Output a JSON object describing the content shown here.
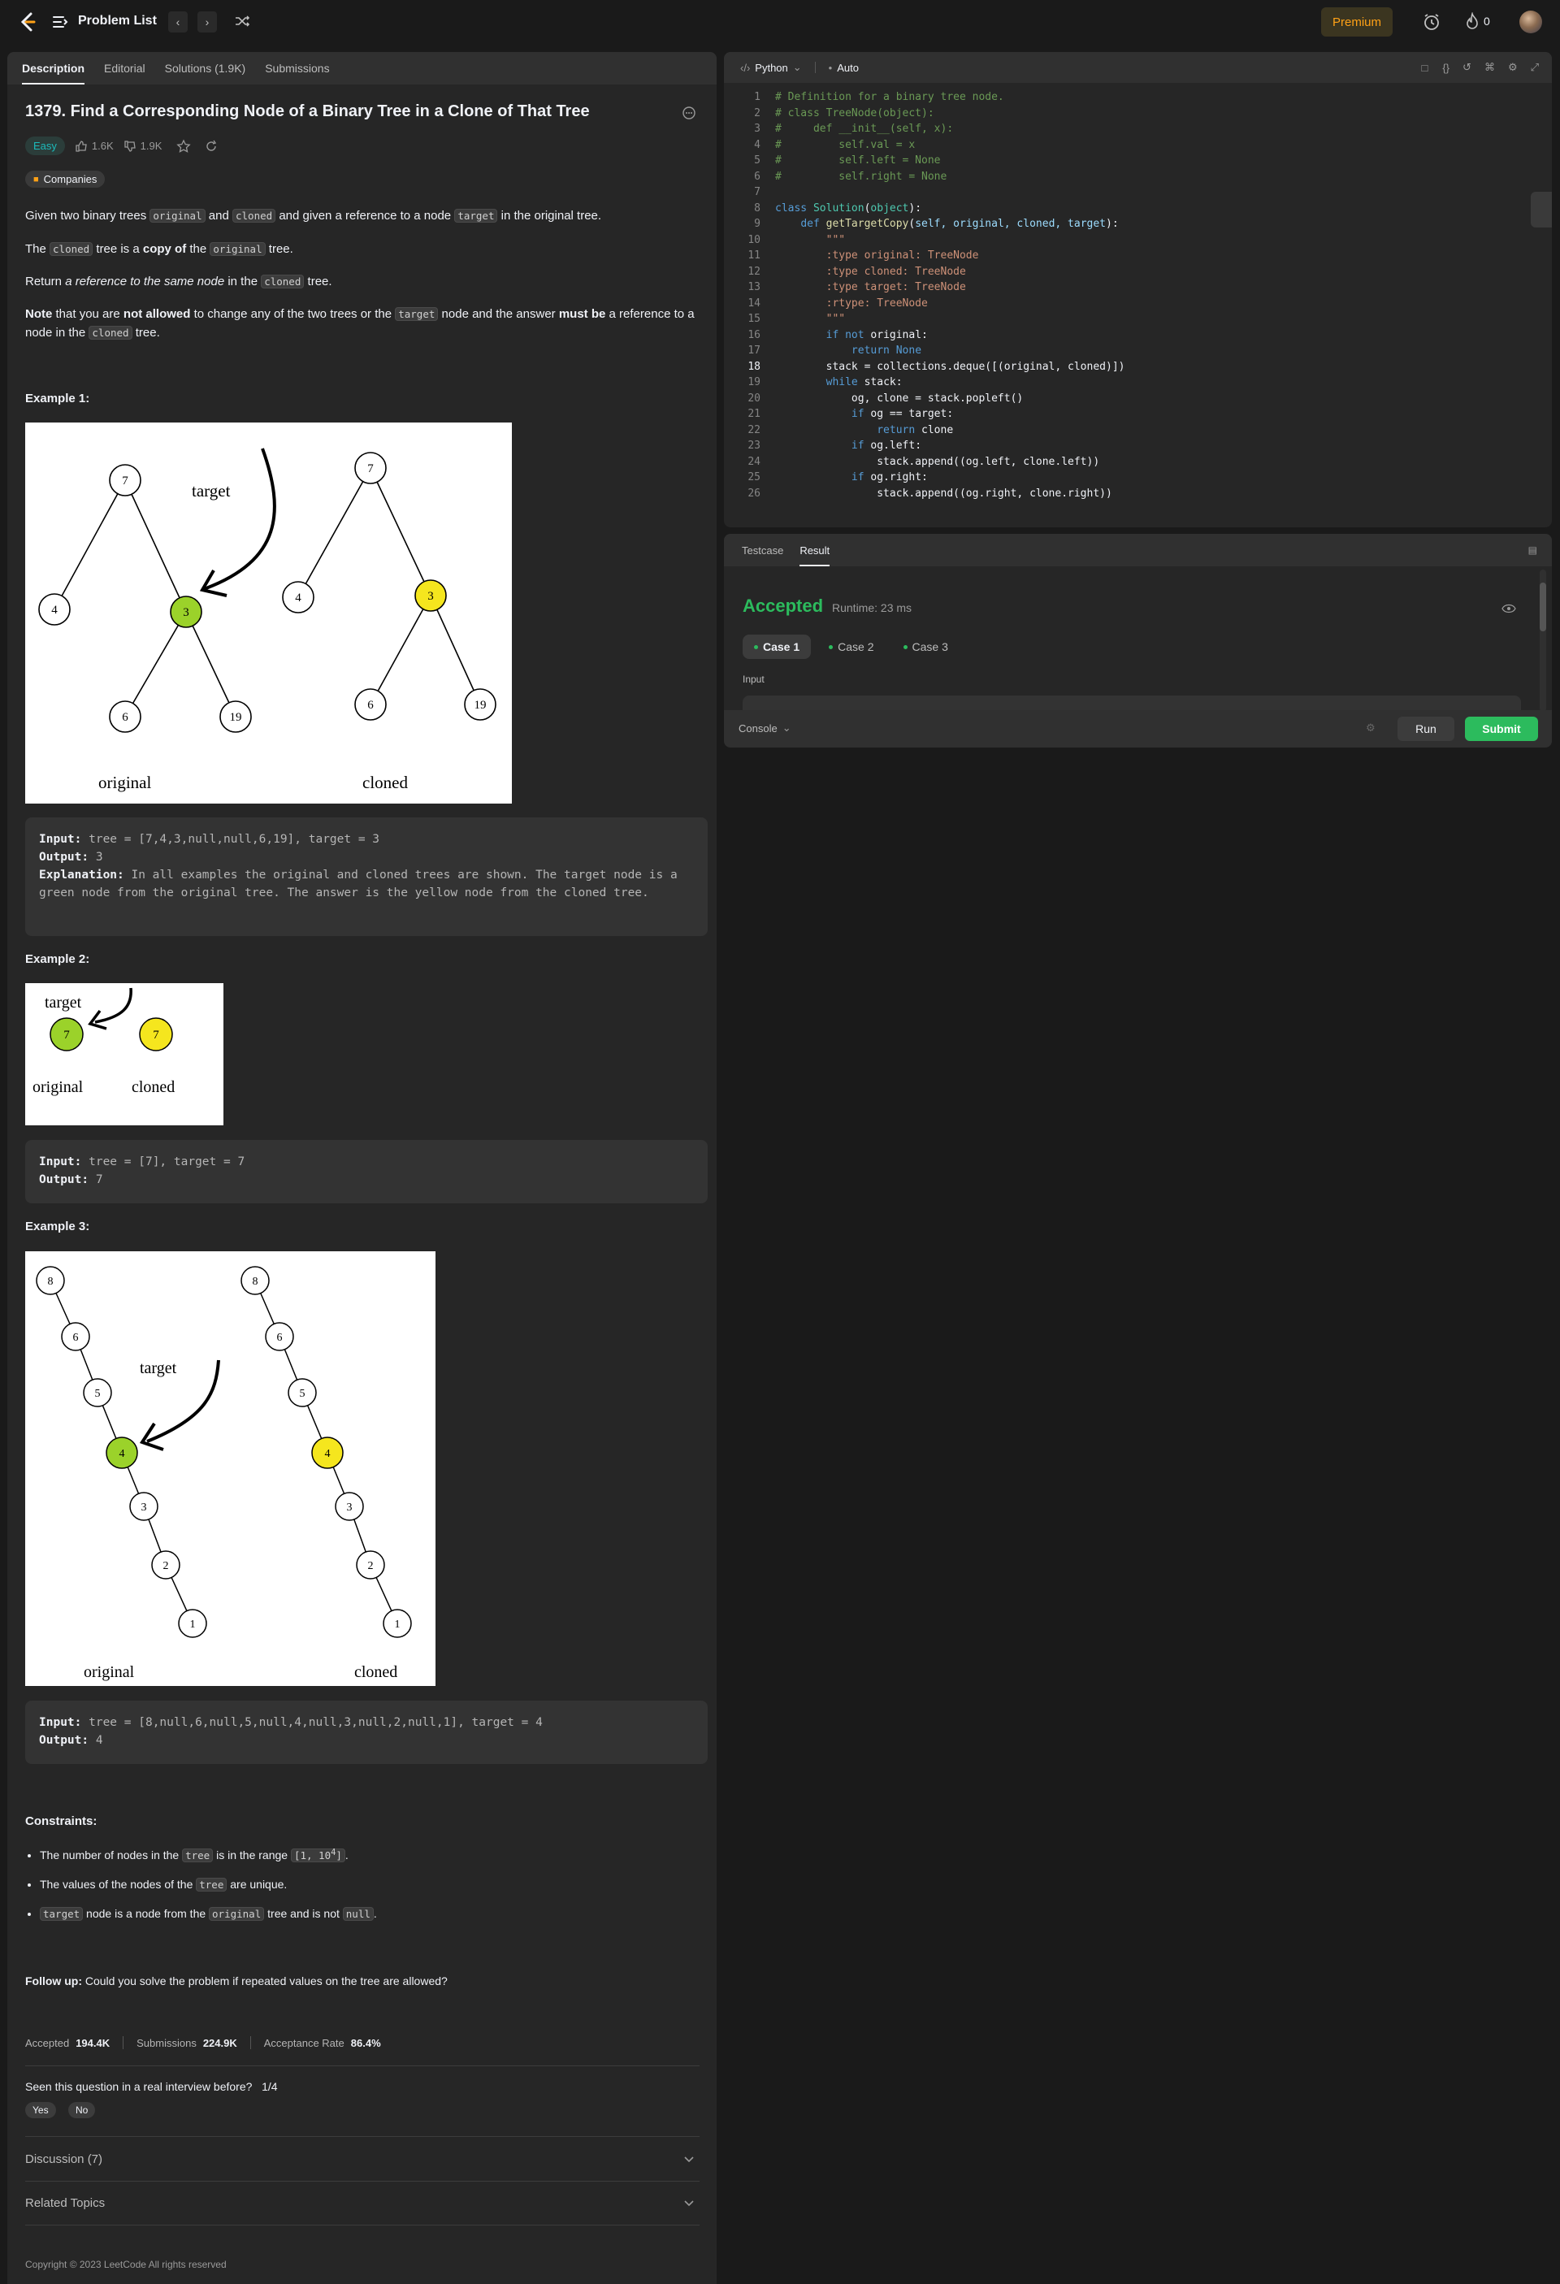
{
  "topbar": {
    "problem_list": "Problem List",
    "premium": "Premium",
    "streak": "0"
  },
  "tabs": [
    "Description",
    "Editorial",
    "Solutions (1.9K)",
    "Submissions"
  ],
  "problem": {
    "title": "1379. Find a Corresponding Node of a Binary Tree in a Clone of That Tree",
    "difficulty": "Easy",
    "likes": "1.6K",
    "dislikes": "1.9K",
    "companies": "Companies",
    "desc1": {
      "a": "Given two binary trees ",
      "c1": "original",
      "b": " and ",
      "c2": "cloned",
      "c": " and given a reference to a node ",
      "c3": "target",
      "d": " in the original tree."
    },
    "desc2": {
      "a": "The ",
      "c1": "cloned",
      "b": " tree is a ",
      "bold": "copy of",
      "c": " the ",
      "c2": "original",
      "d": " tree."
    },
    "desc3": {
      "a": "Return ",
      "i": "a reference to the same node",
      "b": " in the ",
      "c1": "cloned",
      "c": " tree."
    },
    "desc4": {
      "note": "Note",
      "a": " that you are ",
      "b1": "not allowed",
      "b": " to change any of the two trees or the ",
      "c1": "target",
      "c": " node and the answer ",
      "b2": "must be",
      "d": " a reference to a node in the ",
      "c2": "cloned",
      "e": " tree."
    }
  },
  "examples": [
    {
      "heading": "Example 1:",
      "input_label": "Input:",
      "input": " tree = [7,4,3,null,null,6,19], target = 3",
      "output_label": "Output:",
      "output": " 3",
      "expl_label": "Explanation:",
      "expl": " In all examples the original and cloned trees are shown. The target node is a green node from the original tree. The answer is the yellow node from the cloned tree."
    },
    {
      "heading": "Example 2:",
      "input_label": "Input:",
      "input": " tree = [7], target =  7",
      "output_label": "Output:",
      "output": " 7"
    },
    {
      "heading": "Example 3:",
      "input_label": "Input:",
      "input": " tree = [8,null,6,null,5,null,4,null,3,null,2,null,1], target = 4",
      "output_label": "Output:",
      "output": " 4"
    }
  ],
  "figures": {
    "target": "target",
    "original": "original",
    "cloned": "cloned",
    "ex1": {
      "n7": "7",
      "n4": "4",
      "n3": "3",
      "n6": "6",
      "n19": "19"
    },
    "ex2": {
      "n7": "7"
    },
    "ex3": {
      "n8": "8",
      "n6": "6",
      "n5": "5",
      "n4": "4",
      "n3": "3",
      "n2": "2",
      "n1": "1"
    }
  },
  "constraints": {
    "heading": "Constraints:",
    "c1a": "The number of nodes in the ",
    "c1code": "tree",
    "c1b": " is in the range ",
    "c1range": "[1, 10",
    "c1sup": "4",
    "c1end": "]",
    "c1c": ".",
    "c2a": "The values of the nodes of the ",
    "c2code": "tree",
    "c2b": " are unique.",
    "c3code1": "target",
    "c3a": " node is a node from the ",
    "c3code2": "original",
    "c3b": " tree and is not ",
    "c3code3": "null",
    "c3c": "."
  },
  "followup": {
    "label": "Follow up:",
    "text": " Could you solve the problem if repeated values on the tree are allowed?"
  },
  "stats": {
    "accepted_label": "Accepted",
    "accepted": "194.4K",
    "submissions_label": "Submissions",
    "submissions": "224.9K",
    "rate_label": "Acceptance Rate",
    "rate": "86.4%"
  },
  "interview": {
    "question": "Seen this question in a real interview before?",
    "count": "1/4",
    "yes": "Yes",
    "no": "No"
  },
  "discussion": "Discussion (7)",
  "related": "Related Topics",
  "copyright": "Copyright © 2023 LeetCode All rights reserved",
  "editor": {
    "language": "Python",
    "mode": "Auto"
  },
  "code_lines": [
    "# Definition for a binary tree node.",
    "# class TreeNode(object):",
    "#     def __init__(self, x):",
    "#         self.val = x",
    "#         self.left = None",
    "#         self.right = None",
    "",
    "class Solution(object):",
    "    def getTargetCopy(self, original, cloned, target):",
    "        \"\"\"",
    "        :type original: TreeNode",
    "        :type cloned: TreeNode",
    "        :type target: TreeNode",
    "        :rtype: TreeNode",
    "        \"\"\"",
    "        if not original:",
    "            return None",
    "        stack = collections.deque([(original, cloned)])",
    "        while stack:",
    "            og, clone = stack.popleft()",
    "            if og == target:",
    "                return clone",
    "            if og.left:",
    "                stack.append((og.left, clone.left))",
    "            if og.right:",
    "                stack.append((og.right, clone.right))"
  ],
  "result": {
    "tabs": [
      "Testcase",
      "Result"
    ],
    "status": "Accepted",
    "runtime": "Runtime: 23 ms",
    "cases": [
      "Case 1",
      "Case 2",
      "Case 3"
    ],
    "input_label": "Input",
    "console": "Console",
    "run": "Run",
    "submit": "Submit"
  }
}
